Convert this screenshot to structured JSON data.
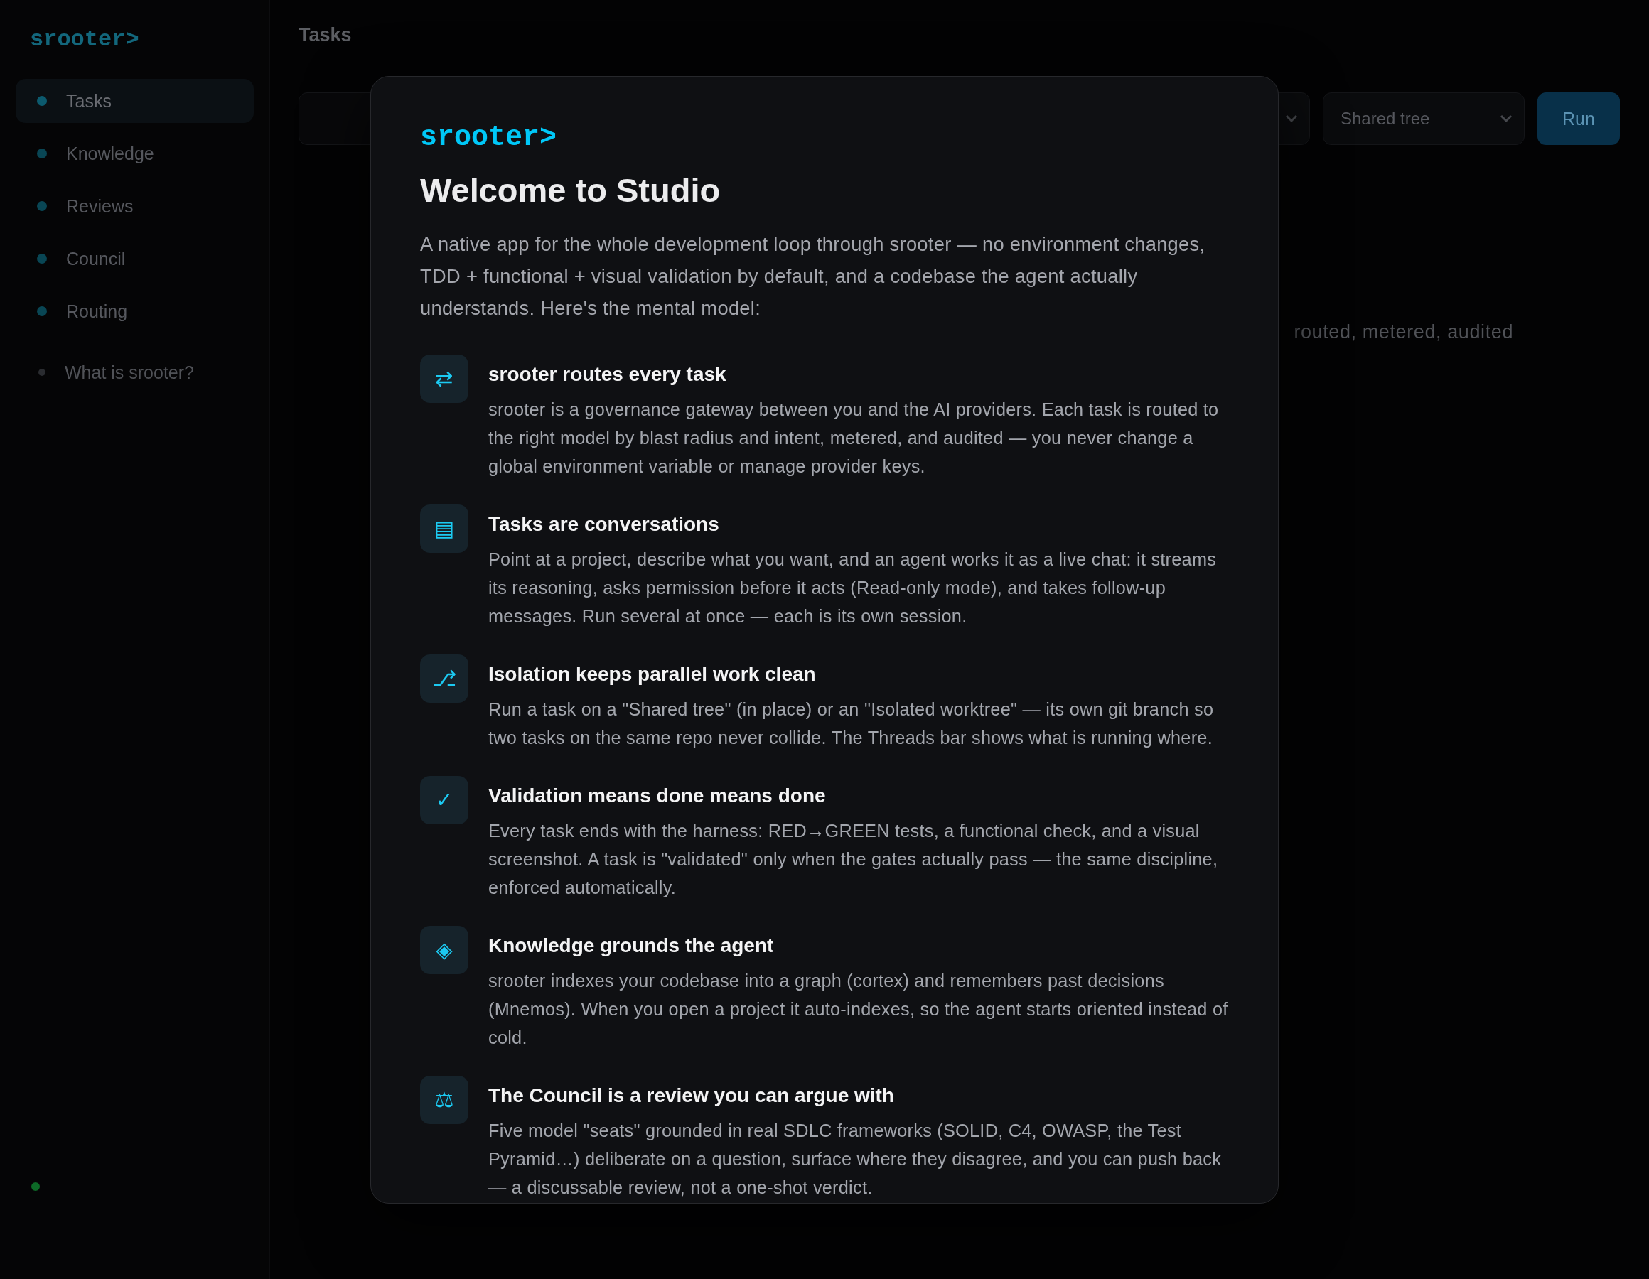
{
  "sidebar": {
    "logo": "srooter>",
    "items": [
      {
        "label": "Tasks",
        "selected": true
      },
      {
        "label": "Knowledge",
        "selected": false
      },
      {
        "label": "Reviews",
        "selected": false
      },
      {
        "label": "Council",
        "selected": false
      },
      {
        "label": "Routing",
        "selected": false
      }
    ],
    "help": "What is srooter?"
  },
  "main": {
    "title": "Tasks",
    "toolbar": {
      "tree_select": "Shared tree",
      "run": "Run"
    },
    "note": "routed, metered, audited"
  },
  "modal": {
    "logo": "srooter>",
    "title": "Welcome to Studio",
    "intro": "A native app for the whole development loop through srooter — no environment changes, TDD + functional + visual validation by default, and a codebase the agent actually understands. Here's the mental model:",
    "items": [
      {
        "icon": "⇄",
        "title": "srooter routes every task",
        "text": "srooter is a governance gateway between you and the AI providers. Each task is routed to the right model by blast radius and intent, metered, and audited — you never change a global environment variable or manage provider keys."
      },
      {
        "icon": "▤",
        "title": "Tasks are conversations",
        "text": "Point at a project, describe what you want, and an agent works it as a live chat: it streams its reasoning, asks permission before it acts (Read-only mode), and takes follow-up messages. Run several at once — each is its own session."
      },
      {
        "icon": "⎇",
        "title": "Isolation keeps parallel work clean",
        "text": "Run a task on a \"Shared tree\" (in place) or an \"Isolated worktree\" — its own git branch so two tasks on the same repo never collide. The Threads bar shows what is running where."
      },
      {
        "icon": "✓",
        "title": "Validation means done means done",
        "text": "Every task ends with the harness: RED→GREEN tests, a functional check, and a visual screenshot. A task is \"validated\" only when the gates actually pass — the same discipline, enforced automatically."
      },
      {
        "icon": "◈",
        "title": "Knowledge grounds the agent",
        "text": "srooter indexes your codebase into a graph (cortex) and remembers past decisions (Mnemos). When you open a project it auto-indexes, so the agent starts oriented instead of cold."
      },
      {
        "icon": "⚖",
        "title": "The Council is a review you can argue with",
        "text": "Five model \"seats\" grounded in real SDLC frameworks (SOLID, C4, OWASP, the Test Pyramid…) deliberate on a question, surface where they disagree, and you can push back — a discussable review, not a one-shot verdict."
      }
    ]
  }
}
